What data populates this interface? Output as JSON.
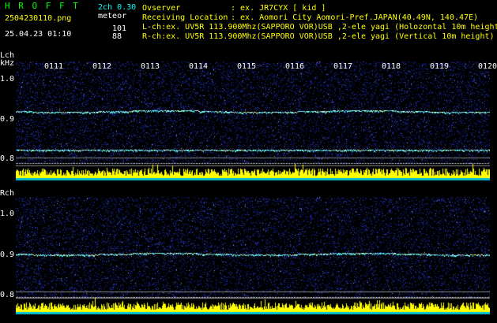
{
  "header": {
    "app_title": "H R O F F T",
    "filename": "2504230110.png",
    "datetime": "25.04.23 01:10",
    "version": "2ch 0.30",
    "meteor_label": "meteor",
    "meteor_count_l": "101",
    "meteor_count_r": "88",
    "observer_label": "Ovserver",
    "observer_value": ": ex. JR7CYX [ kid ]",
    "location_label": "Receiving Location",
    "location_value": ": ex. Aomori City Aomori-Pref.JAPAN(40.49N, 140.47E)",
    "lch_info": "L-ch:ex. UV5R 113.900Mhz(SAPPORO VOR)USB ,2-ele yagi (Holozontal 10m height)",
    "rch_info": "R-ch:ex. UV5R 113.900Mhz(SAPPORO VOR)USB ,2-ele yagi (Vertical 10m height)"
  },
  "lch": {
    "label": "Lch",
    "unit": "kHz",
    "y_ticks": [
      "1.0",
      "0.9",
      "0.8"
    ],
    "time_ticks": [
      "0111",
      "0112",
      "0113",
      "0114",
      "0115",
      "0116",
      "0117",
      "0118",
      "0119",
      "0120"
    ]
  },
  "rch": {
    "label": "Rch",
    "y_ticks": [
      "1.0",
      "0.9",
      "0.8"
    ]
  },
  "colors": {
    "background": "#000000",
    "noise_blue": "#1a2aa0",
    "bar_yellow": "#ffff00",
    "bar_cyan": "#00ffff",
    "header_green": "#00ff00",
    "header_yellow": "#ffff00"
  }
}
